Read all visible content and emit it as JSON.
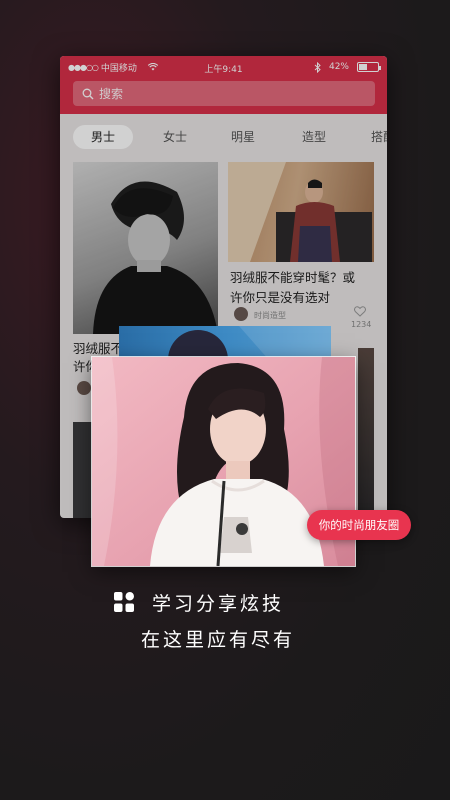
{
  "status_bar": {
    "signal": "●●●○○",
    "carrier": "中国移动",
    "time": "上午9:41",
    "battery": "42%",
    "battery_level": 0.42
  },
  "search": {
    "placeholder": "搜索"
  },
  "tabs": [
    {
      "label": "男士",
      "active": true
    },
    {
      "label": "女士",
      "active": false
    },
    {
      "label": "明星",
      "active": false
    },
    {
      "label": "造型",
      "active": false
    },
    {
      "label": "搭配",
      "active": false
    }
  ],
  "cards": [
    {
      "title_line1": "羽绒服不能穿时髦？或",
      "title_line2": "许你只是没有选对",
      "author": "时尚造型",
      "likes": "1234"
    },
    {
      "title_line1": "羽绒服不",
      "title_line2": "许你"
    }
  ],
  "badge": {
    "label": "你的时尚朋友圈"
  },
  "caption": {
    "line1": "学习分享炫技",
    "line2": "在这里应有尽有"
  },
  "colors": {
    "accent": "#d8304a",
    "badge": "#e8344f",
    "photo_bg": "#e9a9b6"
  },
  "icons": [
    "wifi-icon",
    "bluetooth-icon",
    "battery-icon",
    "search-icon",
    "heart-icon",
    "four-squares-icon"
  ]
}
